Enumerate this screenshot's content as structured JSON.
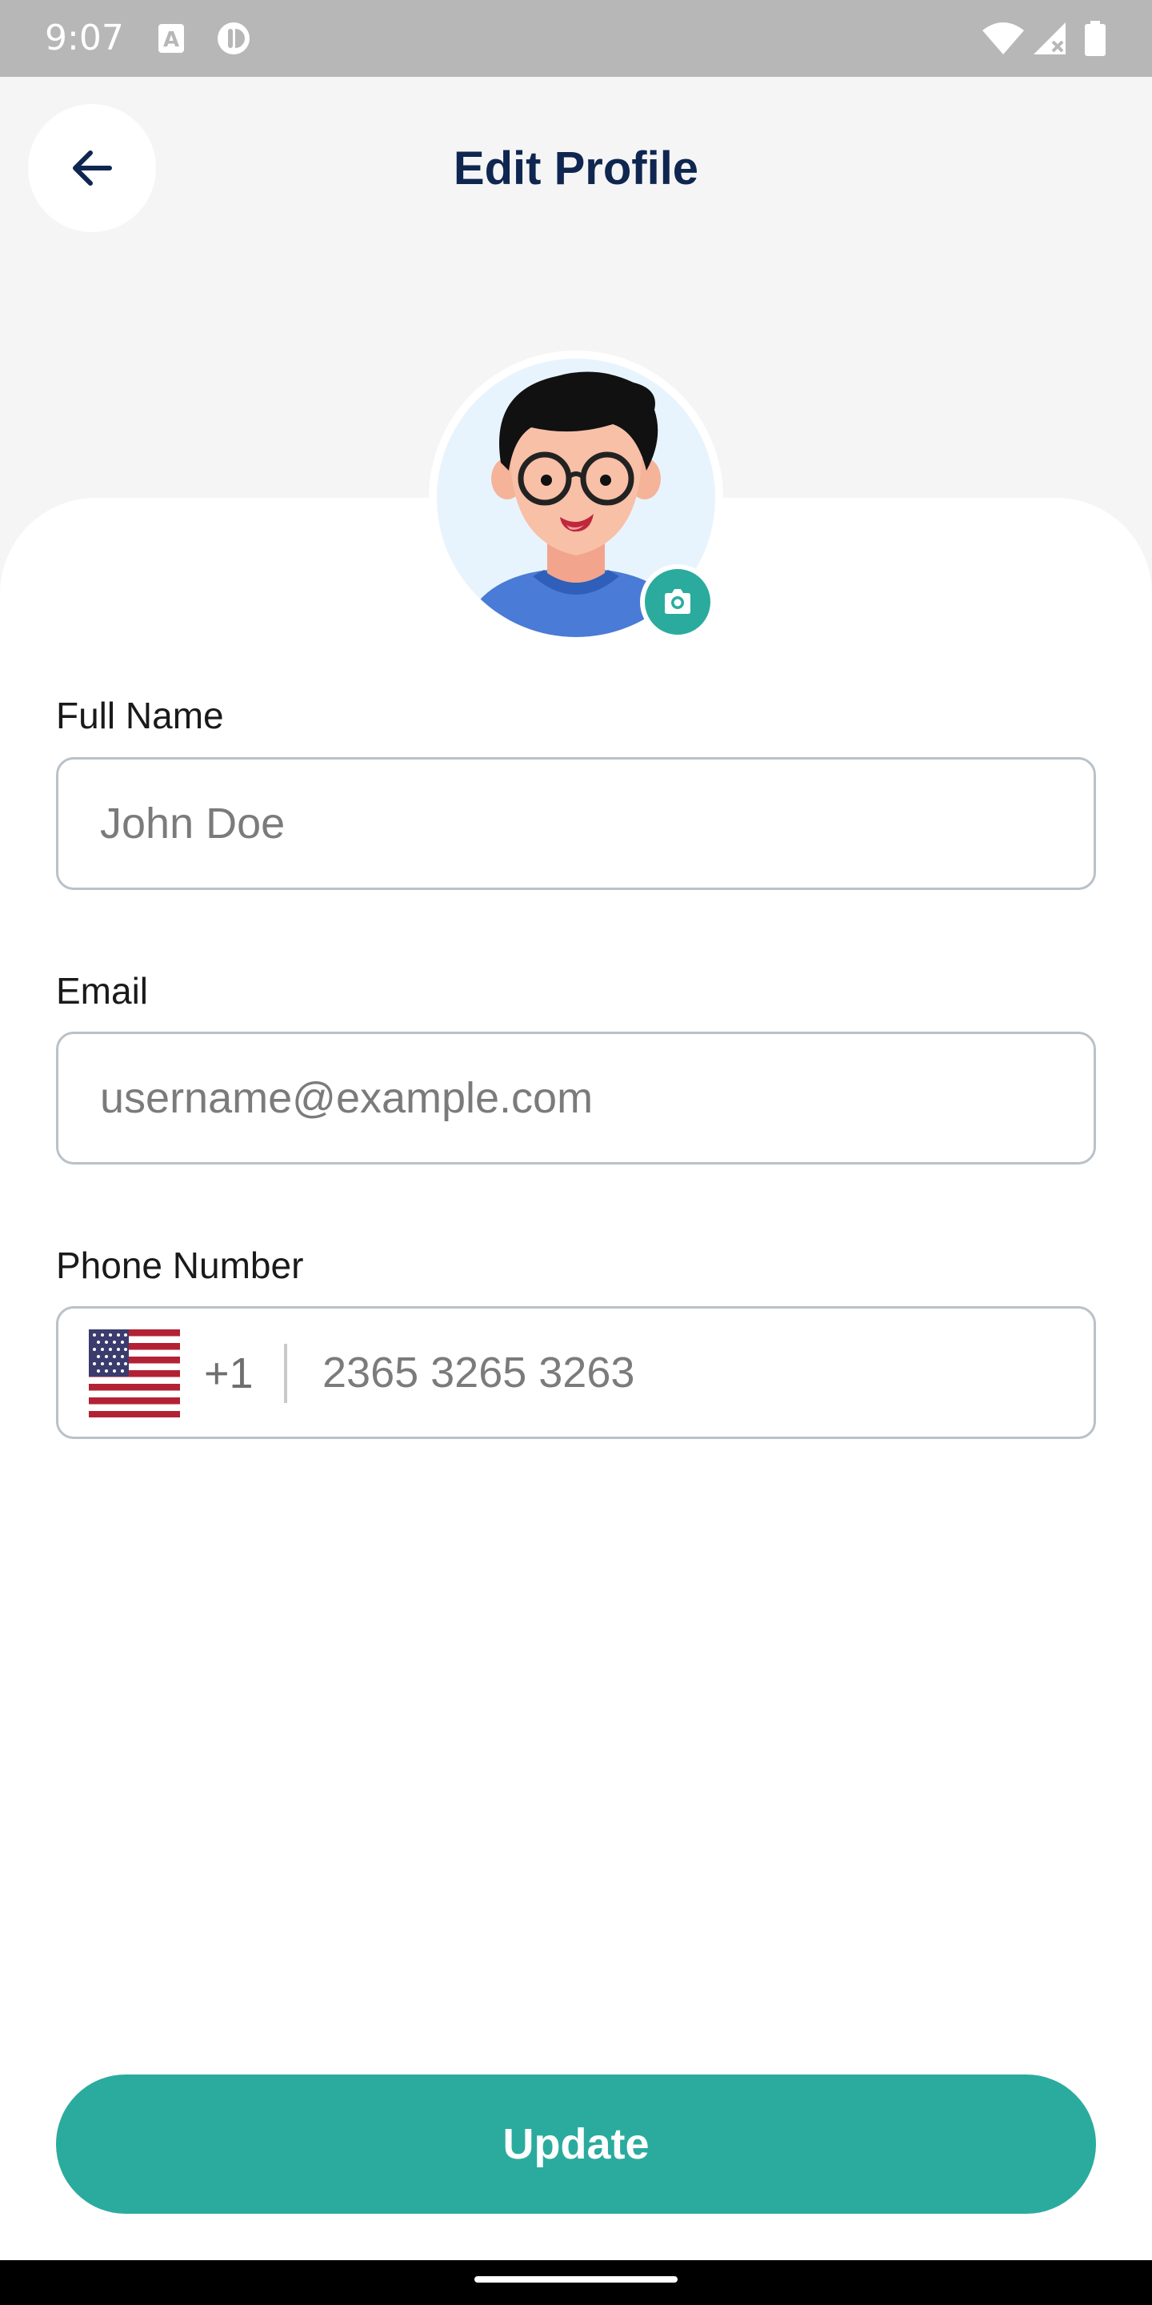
{
  "status_bar": {
    "time": "9:07",
    "icons": [
      "keyboard-a-icon",
      "app-notification-icon",
      "wifi-icon",
      "signal-icon",
      "battery-icon"
    ]
  },
  "header": {
    "title": "Edit Profile",
    "back_icon": "arrow-left-icon"
  },
  "profile": {
    "avatar": "avatar-illustration",
    "camera_icon": "camera-icon"
  },
  "form": {
    "full_name": {
      "label": "Full Name",
      "placeholder": "John Doe",
      "value": ""
    },
    "email": {
      "label": "Email",
      "placeholder": "username@example.com",
      "value": ""
    },
    "phone": {
      "label": "Phone Number",
      "flag": "us-flag-icon",
      "dial_code": "+1",
      "placeholder": "2365 3265 3263",
      "value": ""
    }
  },
  "actions": {
    "update_label": "Update"
  },
  "colors": {
    "accent": "#2bab9e",
    "title": "#0f2650",
    "background": "#f5f5f5",
    "card": "#ffffff"
  }
}
